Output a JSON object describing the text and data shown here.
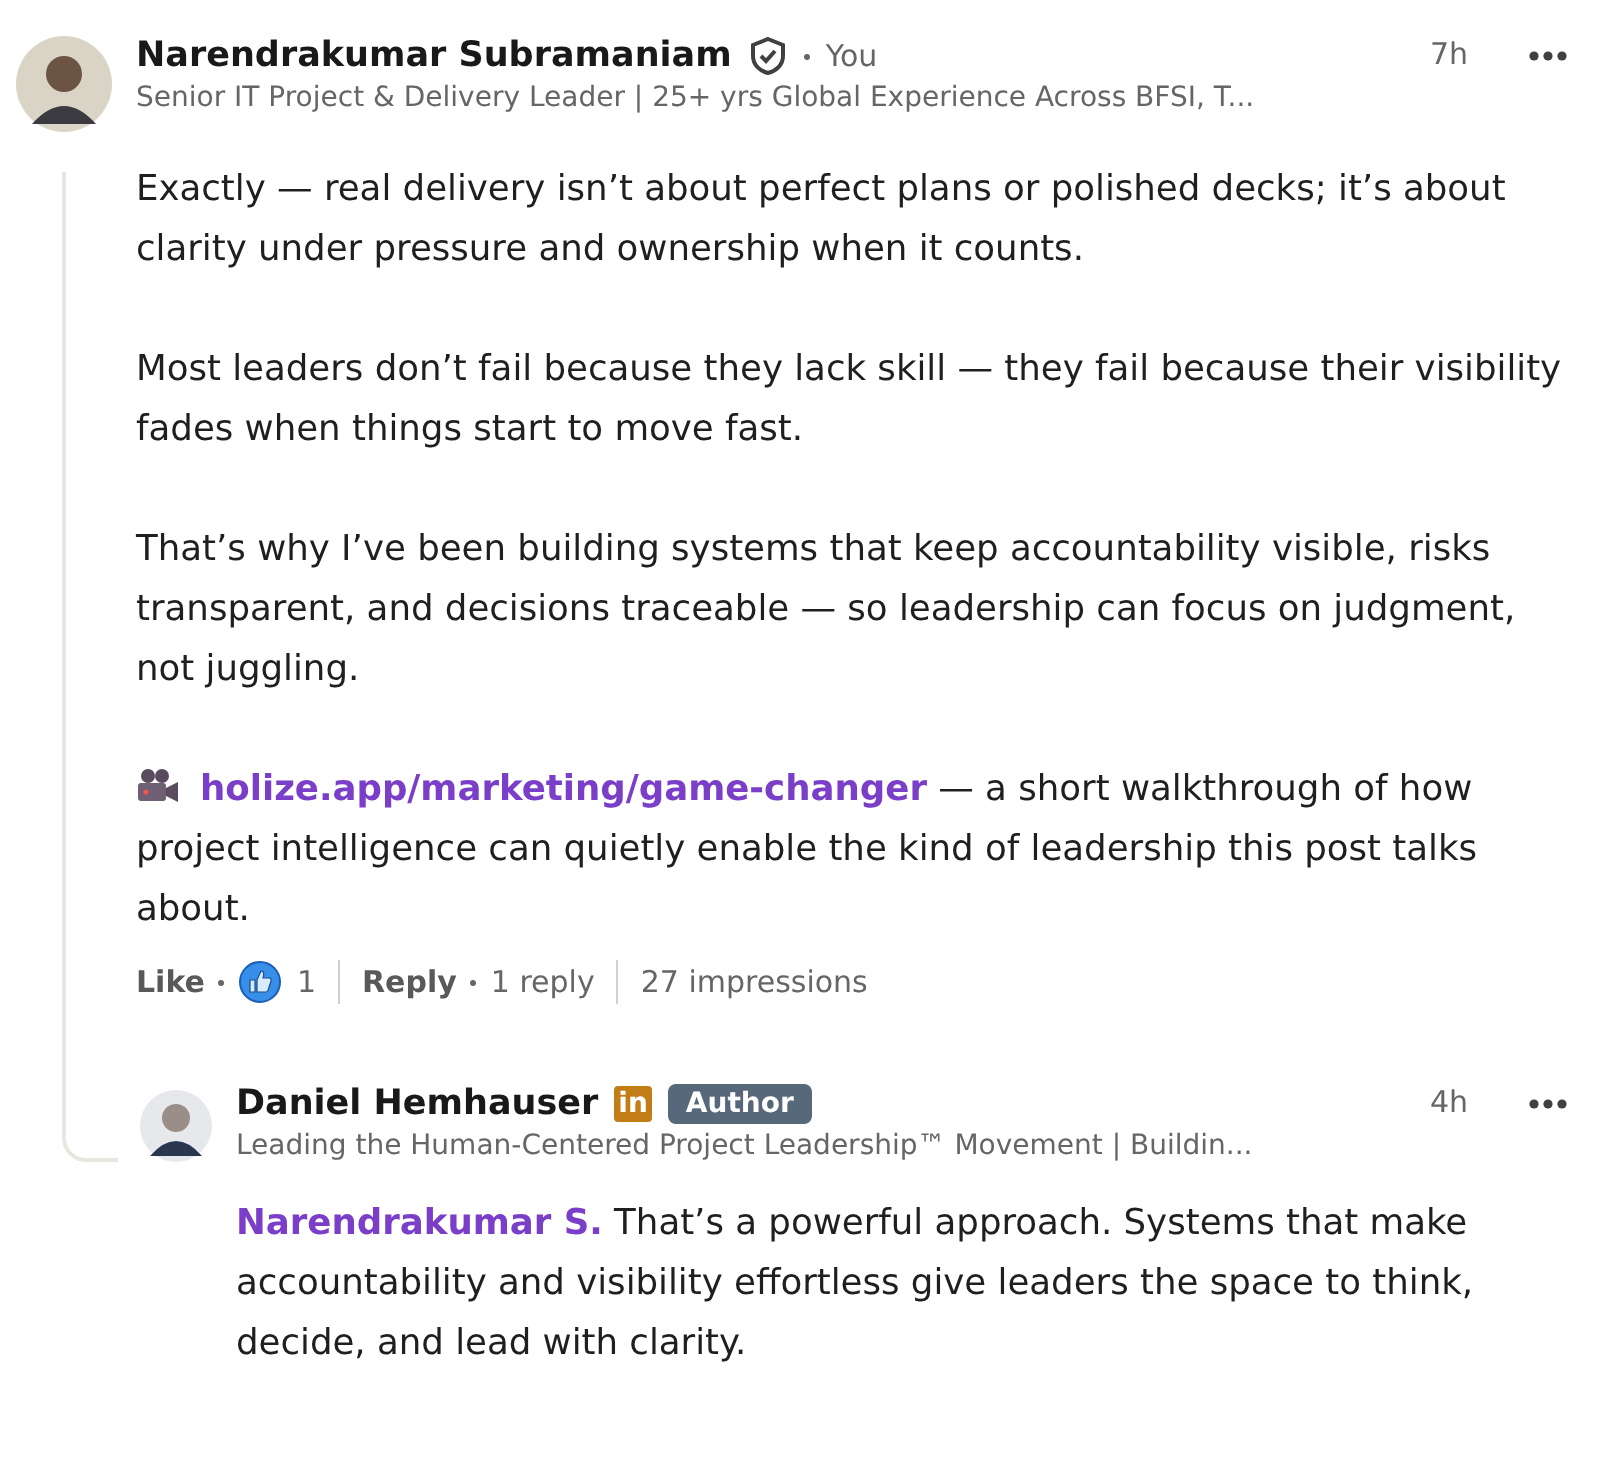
{
  "comment": {
    "author": "Narendrakumar Subramaniam",
    "verified": true,
    "relation": "You",
    "headline": "Senior IT Project & Delivery Leader | 25+ yrs Global Experience Across BFSI, T...",
    "time": "7h",
    "paragraphs": [
      {
        "kind": "text",
        "text": "Exactly — real delivery isn’t about perfect plans or polished decks; it’s about clarity under pressure and ownership when it counts."
      },
      {
        "kind": "text",
        "text": "Most leaders don’t fail because they lack skill — they fail because their visibility fades when things start to move fast."
      },
      {
        "kind": "text",
        "text": " That’s why I’ve been building systems that keep accountability visible, risks transparent, and decisions traceable — so leadership can focus on judgment, not juggling."
      },
      {
        "kind": "link",
        "link": "holize.app/marketing/game-changer",
        "text": " — a short walkthrough of how project intelligence can quietly enable the kind of leadership this post talks about."
      }
    ],
    "actions": {
      "like": "Like",
      "reaction_count": "1",
      "reply": "Reply",
      "reply_count": "1 reply",
      "impressions": "27 impressions"
    }
  },
  "reply": {
    "author": "Daniel Hemhauser",
    "premium_badge": "in",
    "role_badge": "Author",
    "headline": "Leading the Human-Centered Project Leadership™ Movement | Buildin...",
    "time": "4h",
    "mention": "Narendrakumar S.",
    "text": " That’s a powerful approach. Systems that make accountability and visibility effortless give leaders the space to think, decide, and lead with clarity."
  }
}
